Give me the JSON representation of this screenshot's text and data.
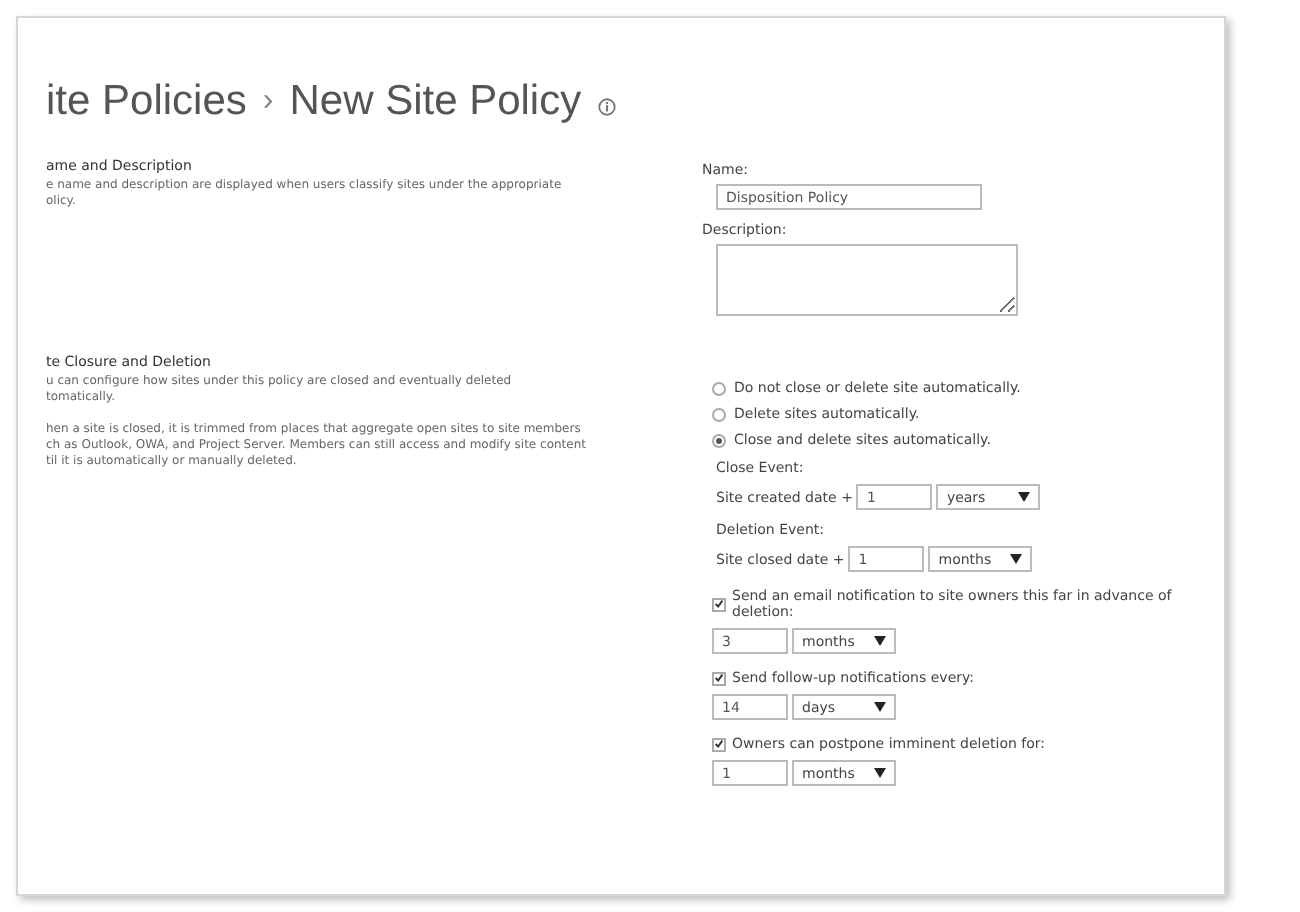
{
  "page": {
    "title": "ite Policies",
    "separator": "›",
    "subtitle": "New Site Policy"
  },
  "sections": [
    {
      "heading": "ame and Description",
      "paragraphs": [
        [
          "e name and description are displayed when users classify sites under the appropriate",
          "olicy."
        ]
      ]
    },
    {
      "heading": "te Closure and Deletion",
      "paragraphs": [
        [
          "u can configure how sites under this policy are closed and eventually deleted",
          "tomatically."
        ],
        [
          "hen a site is closed, it is trimmed from places that aggregate open sites to site members",
          "ch as Outlook, OWA, and Project Server. Members can still access and modify site content",
          "til it is automatically or manually deleted."
        ]
      ]
    }
  ],
  "name_field": {
    "label": "Name:",
    "value": "Disposition Policy"
  },
  "description_field": {
    "label": "Description:"
  },
  "options": [
    {
      "label": "Do not close or delete site automatically.",
      "selected": false
    },
    {
      "label": "Delete sites automatically.",
      "selected": false
    },
    {
      "label": "Close and delete sites automatically.",
      "selected": true
    }
  ],
  "events": [
    {
      "label": "Close Event:",
      "prefix": "Site created date +",
      "number": "1",
      "unit": "years"
    },
    {
      "label": "Deletion Event:",
      "prefix": "Site closed date +",
      "number": "1",
      "unit": "months"
    }
  ],
  "notifications": [
    {
      "label": "Send an email notification to site owners this far in advance of deletion:",
      "checked": true,
      "number": "3",
      "unit": "months"
    },
    {
      "label": "Send follow-up notifications every:",
      "checked": true,
      "number": "14",
      "unit": "days"
    },
    {
      "label": "Owners can postpone imminent deletion for:",
      "checked": true,
      "number": "1",
      "unit": "months"
    }
  ]
}
